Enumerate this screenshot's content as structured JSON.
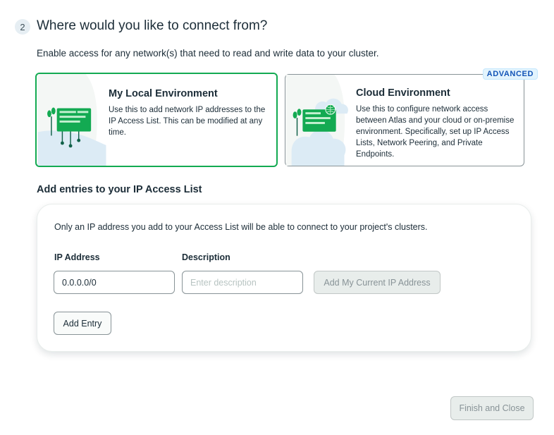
{
  "step": {
    "number": "2",
    "title": "Where would you like to connect from?",
    "subtitle": "Enable access for any network(s) that need to read and write data to your cluster."
  },
  "options": [
    {
      "title": "My Local Environment",
      "description": "Use this to add network IP addresses to the IP Access List. This can be modified at any time.",
      "selected": true,
      "icon": "local-server-icon"
    },
    {
      "title": "Cloud Environment",
      "description": "Use this to configure network access between Atlas and your cloud or on-premise environment. Specifically, set up IP Access Lists, Network Peering, and Private Endpoints.",
      "badge": "ADVANCED",
      "selected": false,
      "icon": "cloud-server-icon"
    }
  ],
  "access_list": {
    "title": "Add entries to your IP Access List",
    "note": "Only an IP address you add to your Access List will be able to connect to your project's clusters.",
    "ip_label": "IP Address",
    "ip_value": "0.0.0.0/0",
    "description_label": "Description",
    "description_placeholder": "Enter description",
    "current_ip_button": "Add My Current IP Address",
    "add_entry_button": "Add Entry"
  },
  "footer": {
    "finish_button": "Finish and Close"
  },
  "colors": {
    "selected_border": "#13aa52",
    "badge_text": "#1254b7",
    "badge_bg": "#e3f4fd"
  }
}
